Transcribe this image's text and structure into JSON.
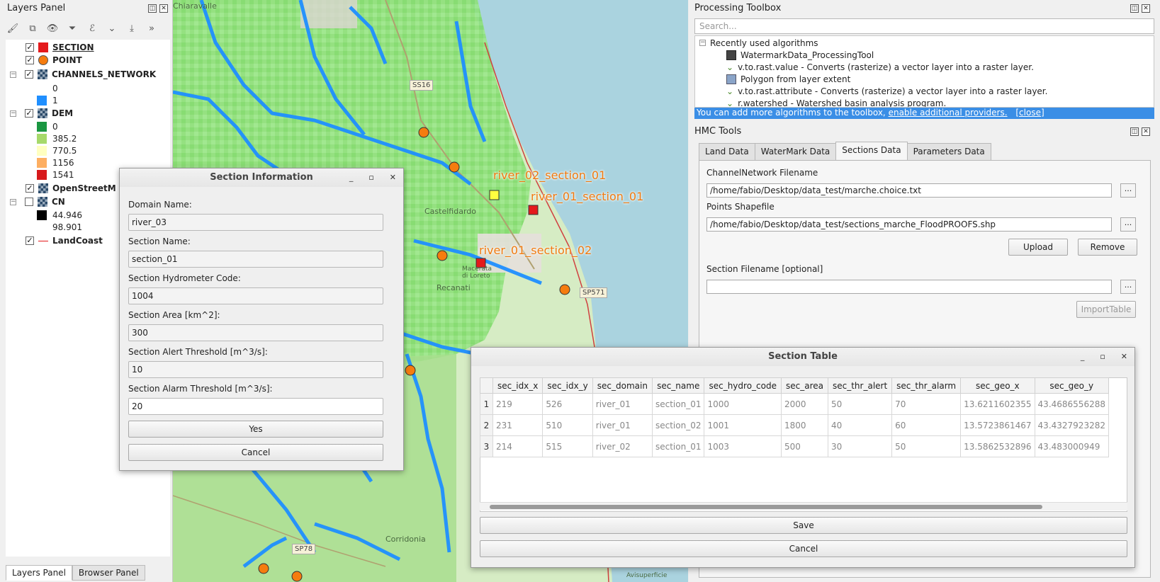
{
  "layers_panel": {
    "title": "Layers Panel",
    "layers": [
      {
        "name": "SECTION",
        "checked": true,
        "symbol": "red-square"
      },
      {
        "name": "POINT",
        "checked": true,
        "symbol": "orange-circle"
      },
      {
        "name": "CHANNELS_NETWORK",
        "checked": true,
        "symbol": "raster"
      },
      {
        "name": "DEM",
        "checked": true,
        "symbol": "raster"
      },
      {
        "name": "OpenStreetM",
        "checked": true,
        "symbol": "raster"
      },
      {
        "name": "CN",
        "checked": false,
        "symbol": "raster"
      },
      {
        "name": "LandCoast",
        "checked": true,
        "symbol": "red-line"
      }
    ],
    "legend_channels": [
      {
        "label": "0",
        "color": "#ffffff"
      },
      {
        "label": "1",
        "color": "#1f8fff"
      }
    ],
    "legend_dem": [
      {
        "label": "0",
        "color": "#1a9641"
      },
      {
        "label": "385.2",
        "color": "#a6d96a"
      },
      {
        "label": "770.5",
        "color": "#ffffc0"
      },
      {
        "label": "1156",
        "color": "#fdae61"
      },
      {
        "label": "1541",
        "color": "#d7191c"
      }
    ],
    "legend_cn": [
      {
        "label": "44.946",
        "color": "#000000"
      },
      {
        "label": "98.901",
        "color": "#ffffff"
      }
    ],
    "bottom_tabs": [
      "Layers Panel",
      "Browser Panel"
    ]
  },
  "map": {
    "place_labels": [
      "Castelfidardo",
      "Recanati",
      "Corridonia",
      "Chiaravalle",
      "Macerata di Loreto",
      "Avisuperficie"
    ],
    "road_signs": [
      "SP571",
      "SP78",
      "SS16"
    ],
    "section_labels": [
      "river_02_section_01",
      "river_01_section_01",
      "river_01_section_02"
    ]
  },
  "processing": {
    "title": "Processing Toolbox",
    "search_placeholder": "Search...",
    "group": "Recently used algorithms",
    "algorithms": [
      "WatermarkData_ProcessingTool",
      "v.to.rast.value - Converts (rasterize) a vector layer into a raster layer.",
      "Polygon from layer extent",
      "v.to.rast.attribute - Converts (rasterize) a vector layer into a raster layer.",
      "r.watershed - Watershed basin analysis program."
    ],
    "info_text": "You can add more algorithms to the toolbox,",
    "info_link": "enable additional providers.",
    "info_close": "[close]"
  },
  "hmc": {
    "title": "HMC Tools",
    "tabs": [
      "Land Data",
      "WaterMark Data",
      "Sections Data",
      "Parameters Data"
    ],
    "channel_label": "ChannelNetwork Filename",
    "channel_value": "/home/fabio/Desktop/data_test/marche.choice.txt",
    "points_label": "Points Shapefile",
    "points_value": "/home/fabio/Desktop/data_test/sections_marche_FloodPROOFS.shp",
    "upload": "Upload",
    "remove": "Remove",
    "section_file_label": "Section Filename [optional]",
    "section_file_value": "",
    "import_table": "ImportTable",
    "browse": "..."
  },
  "section_info": {
    "title": "Section Information",
    "fields": [
      {
        "label": "Domain Name:",
        "value": "river_03"
      },
      {
        "label": "Section Name:",
        "value": "section_01"
      },
      {
        "label": "Section Hydrometer Code:",
        "value": "1004"
      },
      {
        "label": "Section Area [km^2]:",
        "value": "300"
      },
      {
        "label": "Section Alert Threshold [m^3/s]:",
        "value": "10"
      },
      {
        "label": "Section Alarm Threshold [m^3/s]:",
        "value": "20"
      }
    ],
    "yes": "Yes",
    "cancel": "Cancel"
  },
  "section_table": {
    "title": "Section Table",
    "columns": [
      "sec_idx_x",
      "sec_idx_y",
      "sec_domain",
      "sec_name",
      "sec_hydro_code",
      "sec_area",
      "sec_thr_alert",
      "sec_thr_alarm",
      "sec_geo_x",
      "sec_geo_y"
    ],
    "rows": [
      [
        "1",
        "219",
        "526",
        "river_01",
        "section_01",
        "1000",
        "2000",
        "50",
        "70",
        "13.6211602355",
        "43.4686556288"
      ],
      [
        "2",
        "231",
        "510",
        "river_01",
        "section_02",
        "1001",
        "1800",
        "40",
        "60",
        "13.5723861467",
        "43.4327923282"
      ],
      [
        "3",
        "214",
        "515",
        "river_02",
        "section_01",
        "1003",
        "500",
        "30",
        "50",
        "13.5862532896",
        "43.483000949"
      ]
    ],
    "save": "Save",
    "cancel": "Cancel"
  }
}
